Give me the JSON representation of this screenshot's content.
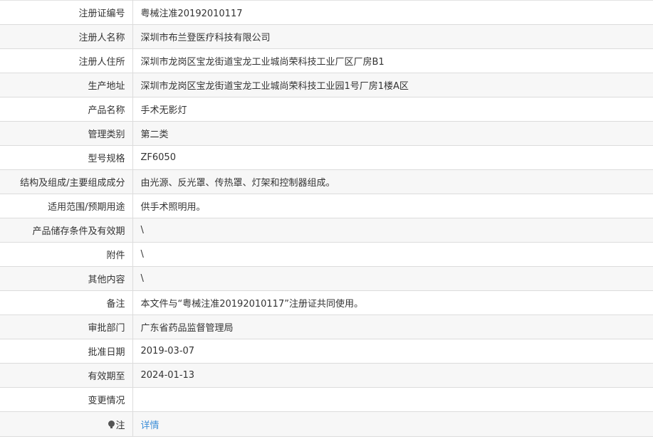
{
  "rows": [
    {
      "label": "注册证编号",
      "value": "粤械注准20192010117"
    },
    {
      "label": "注册人名称",
      "value": "深圳市布兰登医疗科技有限公司"
    },
    {
      "label": "注册人住所",
      "value": "深圳市龙岗区宝龙街道宝龙工业城尚荣科技工业厂区厂房B1"
    },
    {
      "label": "生产地址",
      "value": "深圳市龙岗区宝龙街道宝龙工业城尚荣科技工业园1号厂房1楼A区"
    },
    {
      "label": "产品名称",
      "value": "手术无影灯"
    },
    {
      "label": "管理类别",
      "value": "第二类"
    },
    {
      "label": "型号规格",
      "value": "ZF6050"
    },
    {
      "label": "结构及组成/主要组成成分",
      "value": "由光源、反光罩、传热罩、灯架和控制器组成。"
    },
    {
      "label": "适用范围/预期用途",
      "value": "供手术照明用。"
    },
    {
      "label": "产品储存条件及有效期",
      "value": "\\"
    },
    {
      "label": "附件",
      "value": "\\"
    },
    {
      "label": "其他内容",
      "value": "\\"
    },
    {
      "label": "备注",
      "value": "本文件与“粤械注准20192010117”注册证共同使用。"
    },
    {
      "label": "审批部门",
      "value": "广东省药品监督管理局"
    },
    {
      "label": "批准日期",
      "value": "2019-03-07"
    },
    {
      "label": "有效期至",
      "value": "2024-01-13"
    },
    {
      "label": "变更情况",
      "value": ""
    }
  ],
  "note": {
    "icon": "bulb-icon",
    "label": "注",
    "link_label": "详情",
    "link_color": "#3d8fd8"
  }
}
